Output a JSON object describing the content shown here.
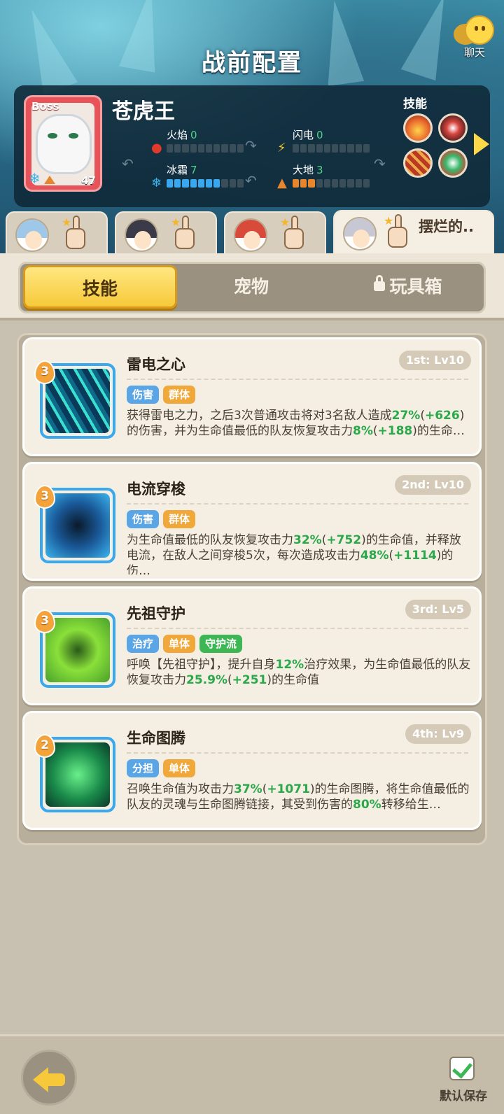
{
  "header": {
    "title": "战前配置",
    "chat_label": "聊天"
  },
  "boss": {
    "badge": "Boss",
    "name": "苍虎王",
    "level": "47",
    "skills_label": "技能",
    "elements": [
      {
        "name": "火焰",
        "value": "0",
        "icon": "fire-icon",
        "level": 0
      },
      {
        "name": "闪电",
        "value": "0",
        "icon": "lightning-icon",
        "level": 0
      },
      {
        "name": "冰霜",
        "value": "7",
        "icon": "frost-icon",
        "level": 7
      },
      {
        "name": "大地",
        "value": "3",
        "icon": "earth-icon",
        "level": 3
      }
    ],
    "element_max": 10
  },
  "heroes": [
    {
      "name": "",
      "active": false
    },
    {
      "name": "",
      "active": false
    },
    {
      "name": "",
      "active": false
    },
    {
      "name": "摆烂的..",
      "active": true
    }
  ],
  "tabs": {
    "skills": "技能",
    "pets": "宠物",
    "toybox": "玩具箱",
    "active": "skills"
  },
  "skills": [
    {
      "name": "雷电之心",
      "slot": "1st: Lv10",
      "cost": "3",
      "tags": [
        {
          "label": "伤害",
          "color": "blue"
        },
        {
          "label": "群体",
          "color": "orange"
        }
      ],
      "desc": "获得雷电之力，之后3次普通攻击将对3名敌人造成27%(+626)的伤害，并为生命值最低的队友恢复攻击力8%(+188)的生命…"
    },
    {
      "name": "电流穿梭",
      "slot": "2nd: Lv10",
      "cost": "3",
      "tags": [
        {
          "label": "伤害",
          "color": "blue"
        },
        {
          "label": "群体",
          "color": "orange"
        }
      ],
      "desc": "为生命值最低的队友恢复攻击力32%(+752)的生命值，并释放电流，在敌人之间穿梭5次，每次造成攻击力48%(+1114)的伤…"
    },
    {
      "name": "先祖守护",
      "slot": "3rd: Lv5",
      "cost": "3",
      "tags": [
        {
          "label": "治疗",
          "color": "blue"
        },
        {
          "label": "单体",
          "color": "orange"
        },
        {
          "label": "守护流",
          "color": "green"
        }
      ],
      "desc": "呼唤【先祖守护】，提升自身12%治疗效果，为生命值最低的队友恢复攻击力25.9%(+251)的生命值"
    },
    {
      "name": "生命图腾",
      "slot": "4th: Lv9",
      "cost": "2",
      "tags": [
        {
          "label": "分担",
          "color": "blue"
        },
        {
          "label": "单体",
          "color": "orange"
        }
      ],
      "desc": "召唤生命值为攻击力37%(+1071)的生命图腾，将生命值最低的队友的灵魂与生命图腾链接，其受到伤害的80%转移给生…"
    }
  ],
  "footer": {
    "save_label": "默认保存"
  }
}
